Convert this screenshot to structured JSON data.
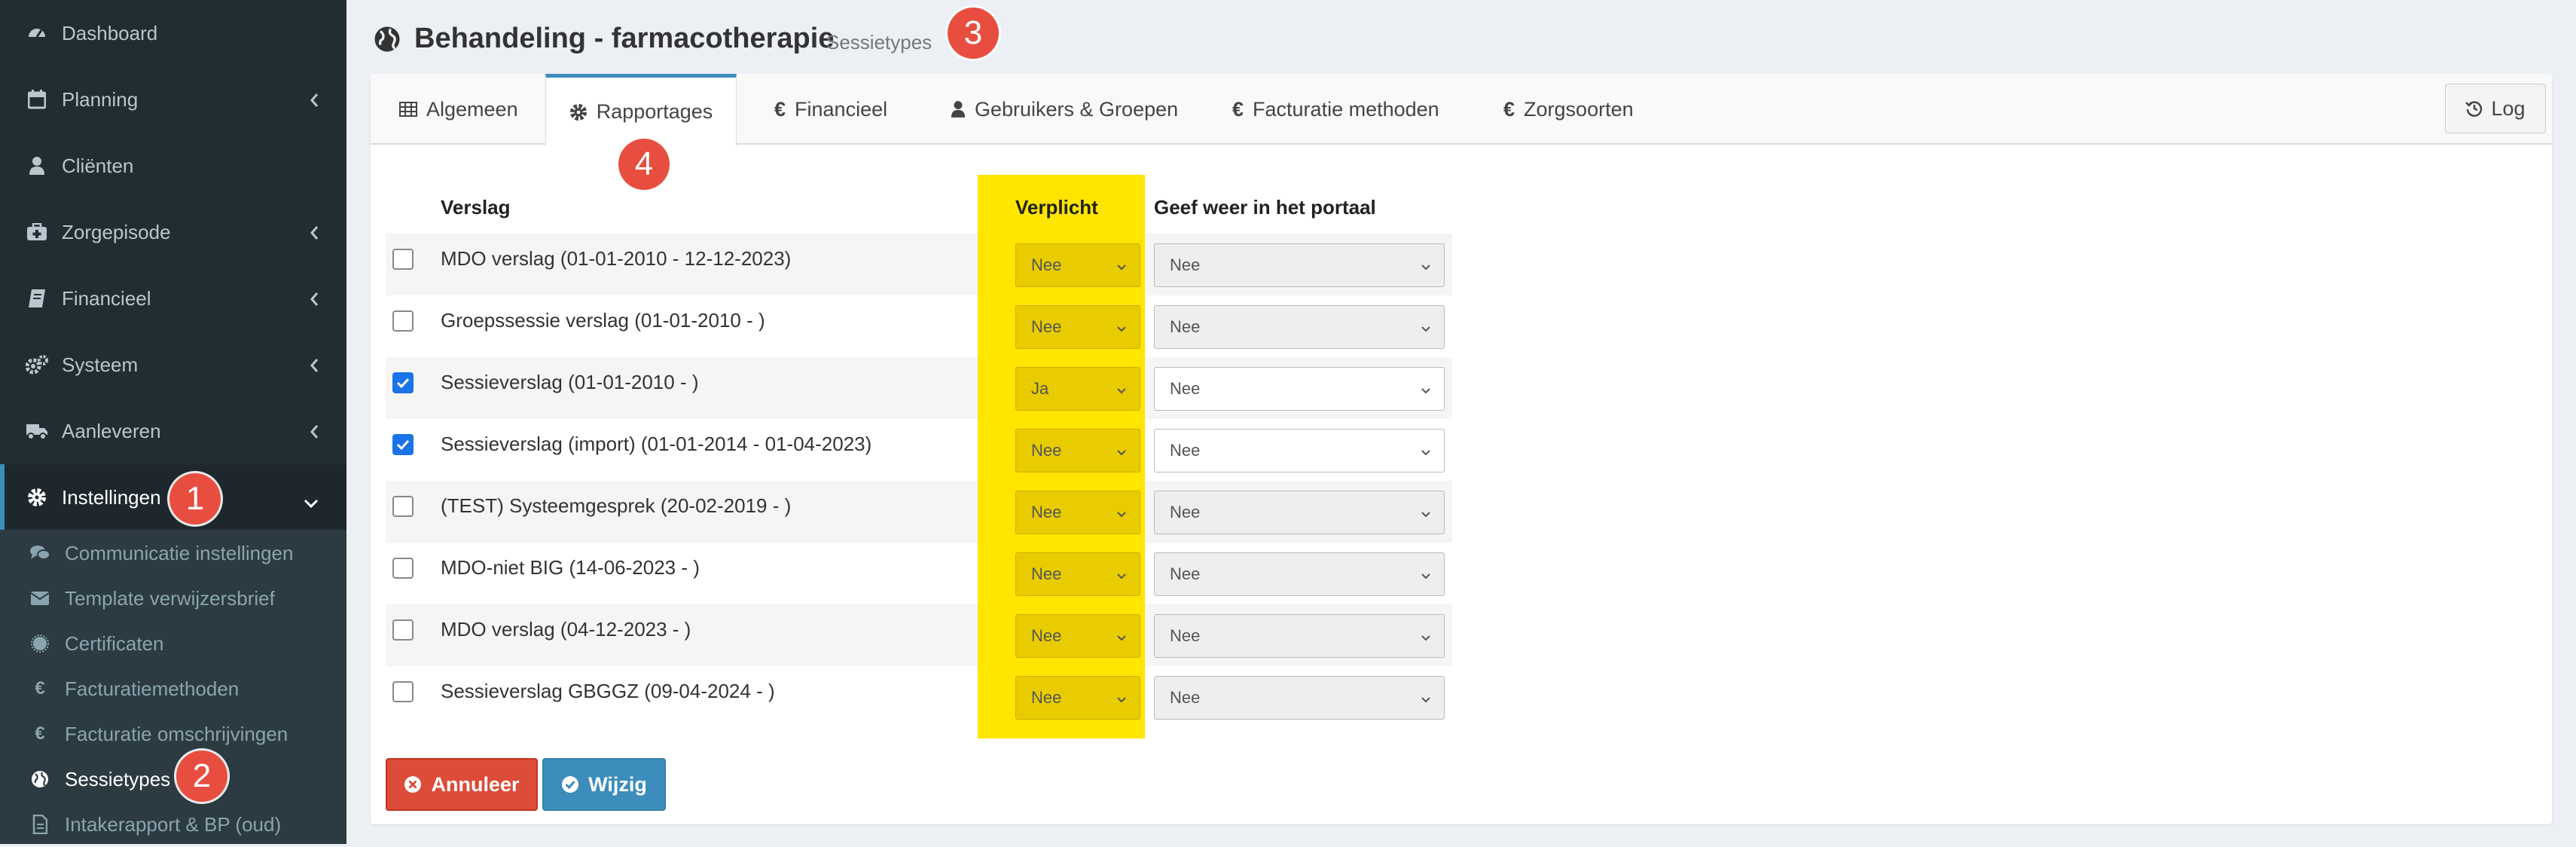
{
  "sidebar": {
    "items": [
      {
        "label": "Dashboard",
        "icon": "dashboard-icon",
        "has_submenu": false
      },
      {
        "label": "Planning",
        "icon": "calendar-icon",
        "has_submenu": true
      },
      {
        "label": "Cliënten",
        "icon": "user-icon",
        "has_submenu": false
      },
      {
        "label": "Zorgepisode",
        "icon": "medkit-icon",
        "has_submenu": true
      },
      {
        "label": "Financieel",
        "icon": "book-icon",
        "has_submenu": true
      },
      {
        "label": "Systeem",
        "icon": "cogs-icon",
        "has_submenu": true
      },
      {
        "label": "Aanleveren",
        "icon": "truck-icon",
        "has_submenu": true
      },
      {
        "label": "Instellingen",
        "icon": "gear-icon",
        "has_submenu": true,
        "expanded": true
      }
    ],
    "submenu": [
      {
        "label": "Communicatie instellingen",
        "icon": "comments-icon"
      },
      {
        "label": "Template verwijzersbrief",
        "icon": "envelope-icon"
      },
      {
        "label": "Certificaten",
        "icon": "certificate-icon"
      },
      {
        "label": "Facturatiemethoden",
        "icon": "euro-icon"
      },
      {
        "label": "Facturatie omschrijvingen",
        "icon": "euro-icon"
      },
      {
        "label": "Sessietypes",
        "icon": "globe-icon",
        "active": true
      },
      {
        "label": "Intakerapport & BP (oud)",
        "icon": "file-icon"
      }
    ]
  },
  "header": {
    "title": "Behandeling - farmacotherapie",
    "subtitle": "Sessietypes"
  },
  "annotations": {
    "badge1": "1",
    "badge2": "2",
    "badge3": "3",
    "badge4": "4"
  },
  "tabs": [
    {
      "label": "Algemeen",
      "icon": "table-icon"
    },
    {
      "label": "Rapportages",
      "icon": "gear-icon",
      "active": true
    },
    {
      "label": "Financieel",
      "icon": "euro-icon"
    },
    {
      "label": "Gebruikers & Groepen",
      "icon": "user-icon"
    },
    {
      "label": "Facturatie methoden",
      "icon": "euro-icon"
    },
    {
      "label": "Zorgsoorten",
      "icon": "euro-icon"
    }
  ],
  "log_button": {
    "label": "Log"
  },
  "table": {
    "headers": {
      "report": "Verslag",
      "required": "Verplicht",
      "portal": "Geef weer in het portaal"
    },
    "rows": [
      {
        "name": "MDO verslag (01-01-2010 - 12-12-2023)",
        "checked": false,
        "required": "Nee",
        "portal": "Nee"
      },
      {
        "name": "Groepssessie verslag (01-01-2010 - )",
        "checked": false,
        "required": "Nee",
        "portal": "Nee"
      },
      {
        "name": "Sessieverslag (01-01-2010 - )",
        "checked": true,
        "required": "Ja",
        "portal": "Nee"
      },
      {
        "name": "Sessieverslag (import) (01-01-2014 - 01-04-2023)",
        "checked": true,
        "required": "Nee",
        "portal": "Nee"
      },
      {
        "name": "(TEST) Systeemgesprek (20-02-2019 - )",
        "checked": false,
        "required": "Nee",
        "portal": "Nee"
      },
      {
        "name": "MDO-niet BIG (14-06-2023 - )",
        "checked": false,
        "required": "Nee",
        "portal": "Nee"
      },
      {
        "name": "MDO verslag (04-12-2023 - )",
        "checked": false,
        "required": "Nee",
        "portal": "Nee"
      },
      {
        "name": "Sessieverslag GBGGZ (09-04-2024 - )",
        "checked": false,
        "required": "Nee",
        "portal": "Nee"
      }
    ]
  },
  "buttons": {
    "cancel": "Annuleer",
    "save": "Wijzig"
  },
  "colors": {
    "sidebar_bg": "#222d32",
    "submenu_bg": "#2c3b41",
    "accent": "#3c8dbc",
    "highlight": "#ffe500",
    "badge": "#e84e40",
    "danger": "#dd4b39"
  }
}
